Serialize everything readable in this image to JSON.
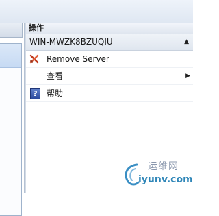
{
  "actions_panel": {
    "header": "操作",
    "server_name": "WIN-MWZK8BZUQIU",
    "items": [
      {
        "label": "Remove Server",
        "icon": "remove-x-icon"
      },
      {
        "label": "查看",
        "icon": "none",
        "submenu": true
      },
      {
        "label": "帮助",
        "icon": "help-icon"
      }
    ]
  },
  "watermark": {
    "cn_text": "运维网",
    "url": "iyunv.com"
  },
  "colors": {
    "header_bg": "#dfe6ef",
    "remove_icon": "#c0391b",
    "help_icon": "#2c4b9e",
    "watermark_url": "#2f86b8"
  }
}
